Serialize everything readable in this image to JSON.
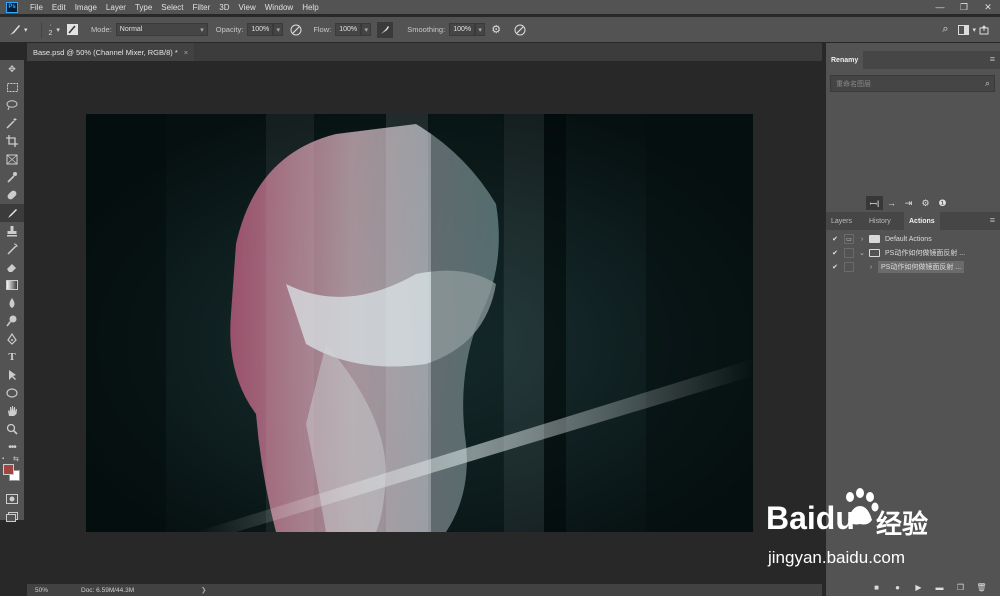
{
  "app": {
    "logo": "Ps"
  },
  "menu": [
    "File",
    "Edit",
    "Image",
    "Layer",
    "Type",
    "Select",
    "Filter",
    "3D",
    "View",
    "Window",
    "Help"
  ],
  "window_controls": {
    "minimize": "—",
    "restore": "❐",
    "close": "✕"
  },
  "options_bar": {
    "brush_size": "2",
    "mode_label": "Mode:",
    "mode_value": "Normal",
    "opacity_label": "Opacity:",
    "opacity_value": "100%",
    "flow_label": "Flow:",
    "flow_value": "100%",
    "smoothing_label": "Smoothing:",
    "smoothing_value": "100%"
  },
  "document": {
    "tab_title": "Base.psd @ 50% (Channel Mixer, RGB/8) *",
    "tab_close": "×",
    "zoom": "50%",
    "doc_info": "Doc: 6.59M/44.3M",
    "status_arrow": "❯"
  },
  "toolbar": {
    "tools": [
      "move-icon",
      "marquee-icon",
      "lasso-icon",
      "magic-wand-icon",
      "crop-icon",
      "frame-icon",
      "eyedropper-icon",
      "healing-icon",
      "brush-icon",
      "stamp-icon",
      "history-brush-icon",
      "eraser-icon",
      "gradient-icon",
      "blur-icon",
      "dodge-icon",
      "pen-icon",
      "type-icon",
      "path-select-icon",
      "shape-icon",
      "hand-icon",
      "zoom-icon",
      "more-icon"
    ],
    "foreground_color": "#a14444",
    "background_color": "#ffffff"
  },
  "renamy": {
    "title": "Renamy",
    "search_placeholder": "重命名图层"
  },
  "panels": {
    "tabs": [
      "Layers",
      "History",
      "Actions"
    ],
    "active_tab": "Actions",
    "actions": [
      {
        "name": "Default Actions",
        "checked": true
      },
      {
        "name": "PS动作如何做镜面反射 ...",
        "checked": true
      },
      {
        "name": "PS动作如何做镜面反射 ...",
        "checked": true
      }
    ]
  },
  "watermark": {
    "brand": "Baidu",
    "brand_cn": "经验",
    "url": "jingyan.baidu.com"
  }
}
